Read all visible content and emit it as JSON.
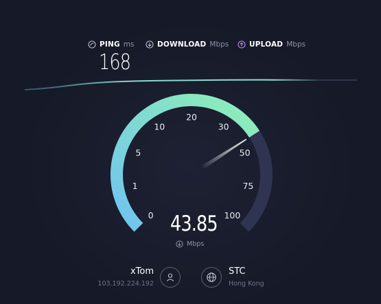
{
  "header": {
    "ping": {
      "label": "PING",
      "unit": "ms",
      "value": "168",
      "icon": "ping-icon"
    },
    "download": {
      "label": "DOWNLOAD",
      "unit": "Mbps",
      "icon": "download-arrow-icon"
    },
    "upload": {
      "label": "UPLOAD",
      "unit": "Mbps",
      "icon": "upload-arrow-icon"
    }
  },
  "gauge": {
    "value": 43.85,
    "value_text": "43.85",
    "unit": "Mbps",
    "ticks": [
      "0",
      "1",
      "5",
      "10",
      "20",
      "30",
      "50",
      "75",
      "100"
    ],
    "colors": {
      "arc_start": "#6fc3f0",
      "arc_end": "#8ff0b5",
      "track": "#2f3550",
      "needle": "#ffffff"
    }
  },
  "servers": {
    "provider": {
      "name": "xTom",
      "ip": "103.192.224.192",
      "icon": "user-icon"
    },
    "host": {
      "name": "STC",
      "location": "Hong Kong",
      "icon": "globe-icon"
    }
  }
}
